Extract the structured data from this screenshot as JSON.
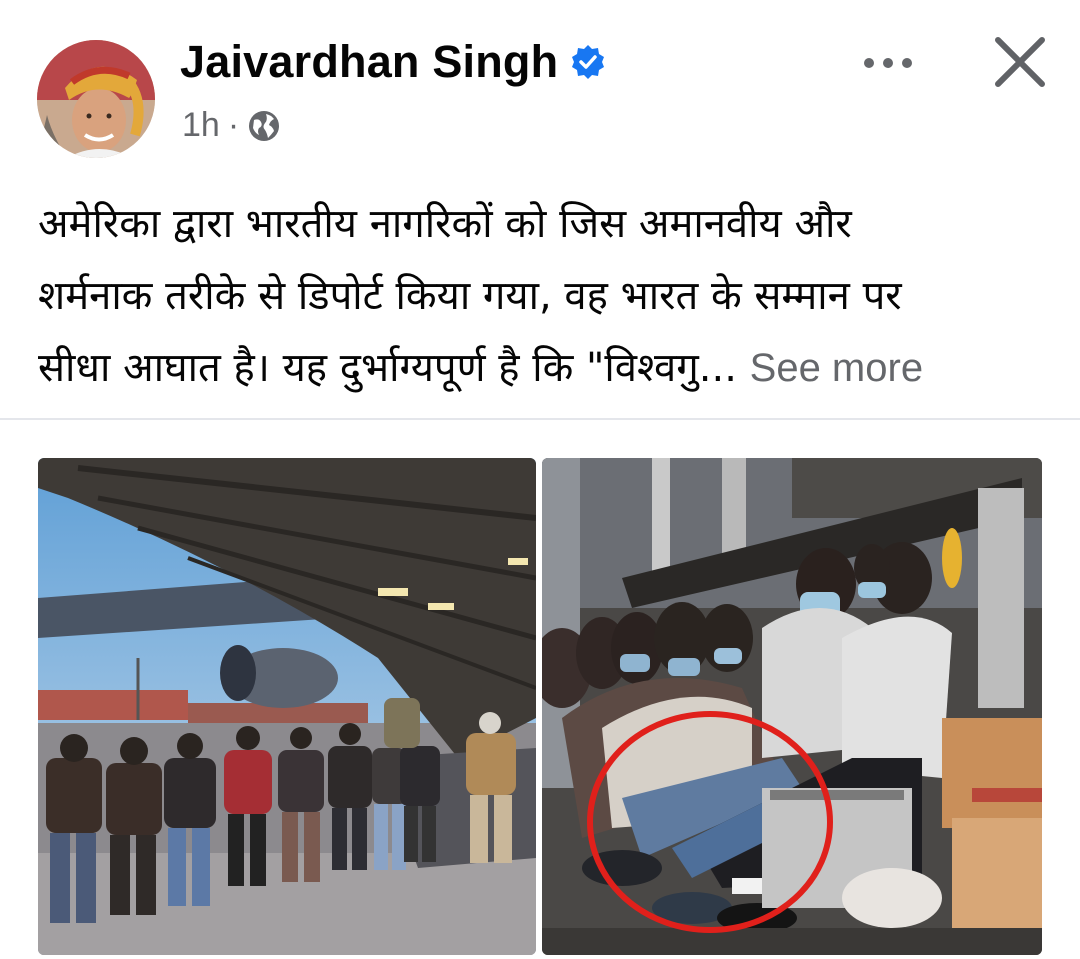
{
  "post": {
    "author": {
      "name": "Jaivardhan Singh",
      "verified": true
    },
    "timestamp": "1h",
    "separator": "·",
    "privacy_icon": "globe-icon",
    "text_lines": [
      "अमेरिका द्वारा भारतीय नागरिकों को जिस अमानवीय और",
      "शर्मनाक तरीके से डिपोर्ट किया गया, वह भारत के सम्मान पर",
      "सीधा आघात है। यह दुर्भाग्यपूर्ण है कि \"विश्वगु..."
    ],
    "see_more": "See more",
    "images": [
      {
        "icon": "airport-deportation-photo"
      },
      {
        "icon": "aircraft-interior-photo"
      }
    ]
  },
  "colors": {
    "verified_badge": "#1877f2",
    "secondary_text": "#65676b",
    "highlight_circle": "#e0201b"
  }
}
